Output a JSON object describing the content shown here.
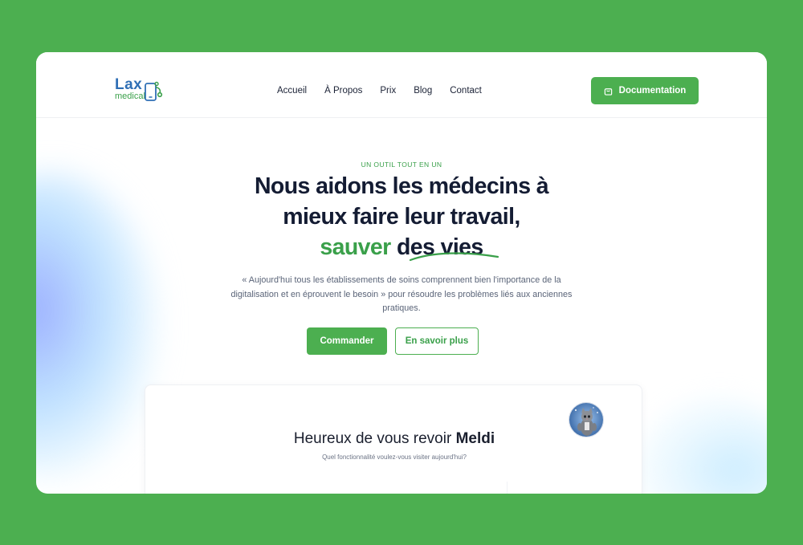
{
  "brand": {
    "name": "Lax",
    "tagline": "medical",
    "colors": {
      "primary": "#4caf50",
      "logo_blue": "#2f6fb5",
      "heading": "#141c33"
    }
  },
  "nav": {
    "items": [
      {
        "label": "Accueil"
      },
      {
        "label": "À Propos"
      },
      {
        "label": "Prix"
      },
      {
        "label": "Blog"
      },
      {
        "label": "Contact"
      }
    ],
    "cta": {
      "label": "Documentation",
      "icon": "shopping-bag-icon"
    }
  },
  "hero": {
    "eyebrow": "UN OUTIL TOUT EN UN",
    "headline_line1": "Nous aidons les médecins à",
    "headline_line2": "mieux faire leur travail,",
    "headline_highlight": "sauver",
    "headline_end": "des vies",
    "subtext": "« Aujourd'hui tous les établissements de soins comprennent bien l'importance de la digitalisation et en éprouvent le besoin » pour résoudre les problèmes liés aux anciennes pratiques.",
    "primary_cta": "Commander",
    "secondary_cta": "En savoir plus"
  },
  "preview": {
    "greeting": "Heureux de vous revoir",
    "user_name": "Meldi",
    "question": "Quel fonctionnalité voulez-vous visiter aujourd'hui?",
    "avatar_icon": "cat-avatar-icon"
  }
}
